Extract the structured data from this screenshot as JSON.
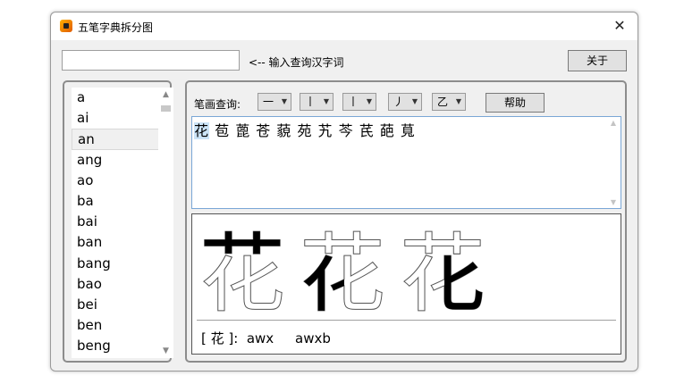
{
  "window": {
    "title": "五笔字典拆分图",
    "close_glyph": "✕"
  },
  "query": {
    "value": "",
    "hint": "<-- 输入查询汉字词"
  },
  "buttons": {
    "about": "关于",
    "help": "帮助"
  },
  "pinyin_list": {
    "items": [
      "a",
      "ai",
      "an",
      "ang",
      "ao",
      "ba",
      "bai",
      "ban",
      "bang",
      "bao",
      "bei",
      "ben",
      "beng"
    ],
    "selected": "an"
  },
  "stroke_filter": {
    "label": "笔画查询:",
    "options": [
      "一",
      "丨",
      "丨",
      "丿",
      "乙"
    ]
  },
  "results": {
    "selected_char": "花",
    "other_chars": "苞 蓖 苍 藐 苑 艽 芩 芪 葩 萈"
  },
  "decomposition": {
    "character": "花",
    "code_line": "[ 花 ]:  awx     awxb"
  },
  "colors": {
    "selection": "#cce4f7",
    "result_border": "#7aa7d6"
  }
}
